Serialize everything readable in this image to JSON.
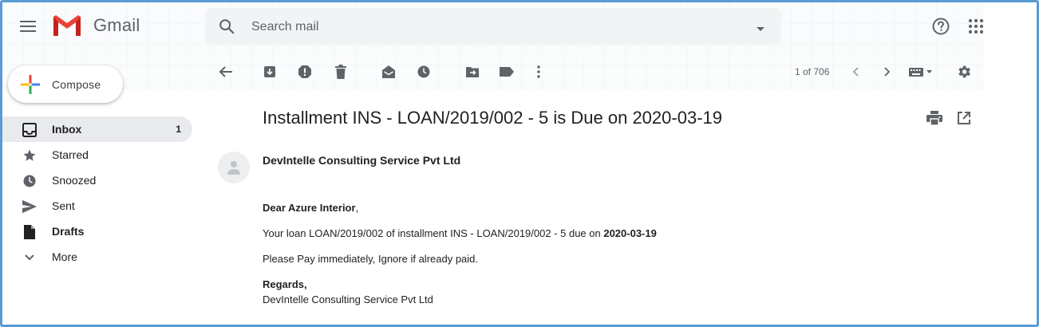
{
  "app": {
    "name": "Gmail"
  },
  "search": {
    "placeholder": "Search mail"
  },
  "compose": {
    "label": "Compose"
  },
  "sidebar": {
    "items": [
      {
        "label": "Inbox",
        "count": "1",
        "icon": "inbox-icon"
      },
      {
        "label": "Starred",
        "icon": "star-icon"
      },
      {
        "label": "Snoozed",
        "icon": "clock-icon"
      },
      {
        "label": "Sent",
        "icon": "send-icon"
      },
      {
        "label": "Drafts",
        "icon": "draft-icon"
      },
      {
        "label": "More",
        "icon": "chevron-down-icon"
      }
    ]
  },
  "toolbar": {
    "pager": "1 of 706"
  },
  "message": {
    "subject": "Installment INS - LOAN/2019/002 - 5 is Due on 2020-03-19",
    "sender": "DevIntelle Consulting Service Pvt Ltd",
    "greeting_name": "Dear Azure Interior",
    "greeting_punct": ",",
    "line1_prefix": "Your loan LOAN/2019/002 of installment INS - LOAN/2019/002 - 5 due on ",
    "line1_date": "2020-03-19",
    "line2": "Please Pay immediately, Ignore if already paid.",
    "regards": "Regards,",
    "signature": "DevIntelle Consulting Service Pvt Ltd"
  },
  "colors": {
    "accent": "#ea4335",
    "border": "#5b9bd5",
    "active_nav": "#e8eaed"
  }
}
